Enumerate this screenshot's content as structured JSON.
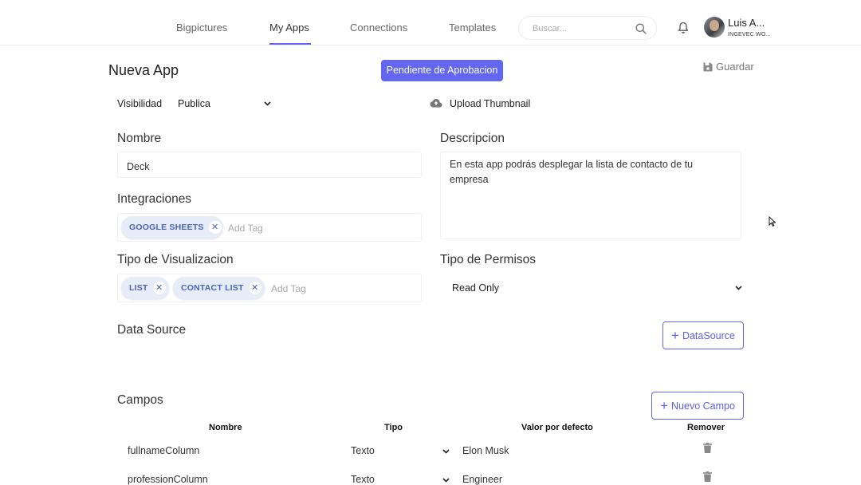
{
  "nav": {
    "items": [
      {
        "label": "Bigpictures"
      },
      {
        "label": "My Apps"
      },
      {
        "label": "Connections"
      },
      {
        "label": "Templates"
      }
    ],
    "active_index": 1,
    "search_placeholder": "Buscar...",
    "user_name": "Luis A...",
    "user_org": "INGEVEC WO..."
  },
  "header": {
    "title": "Nueva App",
    "status": "Pendiente de Aprobacion",
    "save_label": "Guardar"
  },
  "form": {
    "visibility_label": "Visibilidad",
    "visibility_value": "Publica",
    "upload_label": "Upload Thumbnail",
    "name_label": "Nombre",
    "name_value": "Deck",
    "description_label": "Descripcion",
    "description_value": "En esta app podrás desplegar la lista de contacto de tu empresa",
    "integrations_label": "Integraciones",
    "integrations_tags": [
      "GOOGLE SHEETS"
    ],
    "visualization_label": "Tipo de Visualizacion",
    "visualization_tags": [
      "LIST",
      "CONTACT LIST"
    ],
    "add_tag_placeholder": "Add Tag",
    "permissions_label": "Tipo de Permisos",
    "permissions_value": "Read Only",
    "datasource_label": "Data Source",
    "datasource_button": "DataSource",
    "fields_label": "Campos",
    "new_field_button": "Nuevo Campo"
  },
  "fields_table": {
    "headers": [
      "Nombre",
      "Tipo",
      "Valor por defecto",
      "Remover"
    ],
    "rows": [
      {
        "name": "fullnameColumn",
        "type": "Texto",
        "default": "Elon Musk"
      },
      {
        "name": "professionColumn",
        "type": "Texto",
        "default": "Engineer"
      }
    ]
  },
  "colors": {
    "accent": "#6366f1",
    "tag_bg": "#e6ecf8",
    "tag_text": "#4a63b8"
  },
  "icons": [
    "search-icon",
    "bell-icon",
    "save-icon",
    "cloud-upload-icon",
    "close-icon",
    "plus-icon",
    "chevron-down-icon",
    "trash-icon",
    "cursor-icon"
  ]
}
